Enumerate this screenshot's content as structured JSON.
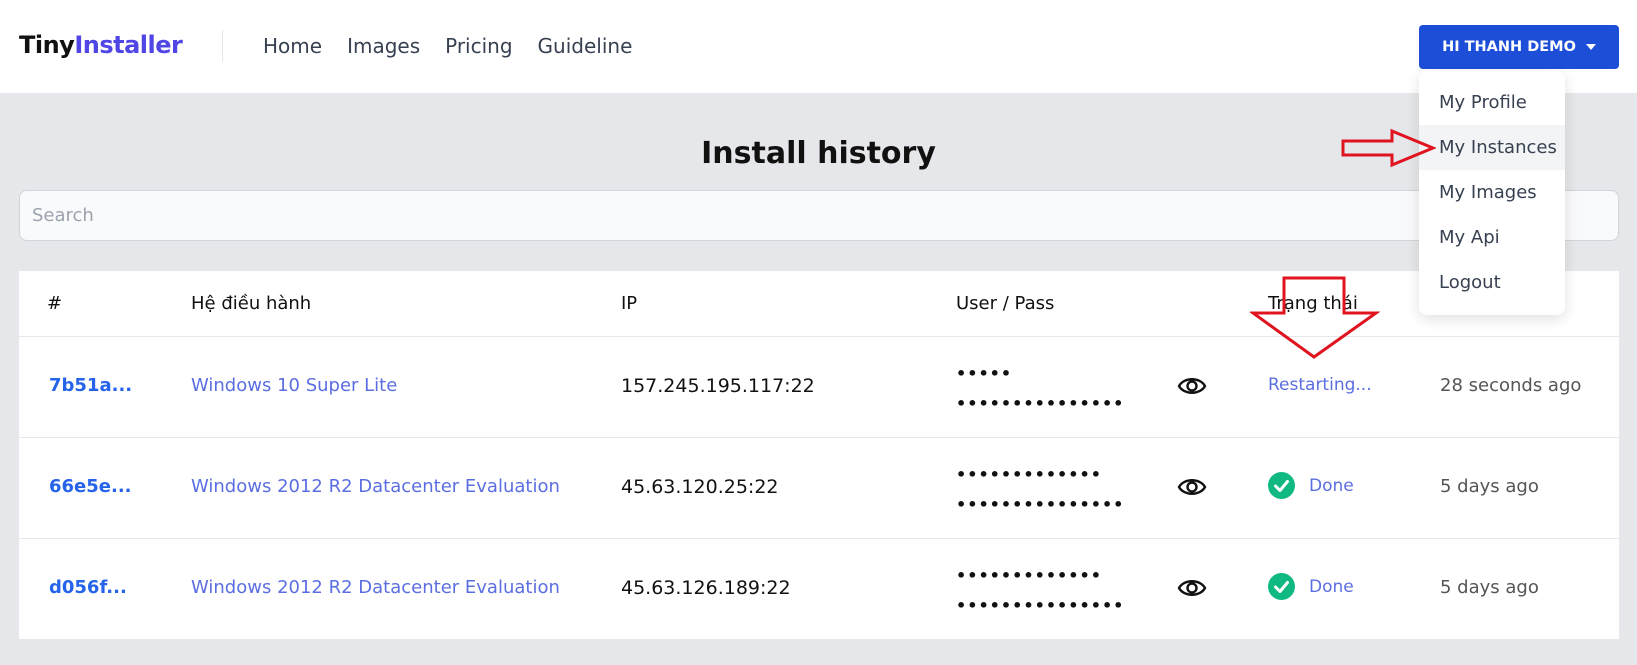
{
  "brand": {
    "part1": "Tiny",
    "part2": "Installer"
  },
  "nav": {
    "items": [
      {
        "label": "Home"
      },
      {
        "label": "Images"
      },
      {
        "label": "Pricing"
      },
      {
        "label": "Guideline"
      }
    ]
  },
  "user_menu": {
    "button_label": "HI THANH DEMO",
    "items": [
      {
        "label": "My Profile"
      },
      {
        "label": "My Instances"
      },
      {
        "label": "My Images"
      },
      {
        "label": "My Api"
      },
      {
        "label": "Logout"
      }
    ],
    "active_item": "My Instances"
  },
  "page": {
    "title": "Install history"
  },
  "search": {
    "placeholder": "Search",
    "value": ""
  },
  "table": {
    "headers": {
      "id": "#",
      "os": "Hệ điều hành",
      "ip": "IP",
      "user_pass": "User / Pass",
      "status": "Trạng thái"
    },
    "rows": [
      {
        "id": "7b51a...",
        "os": "Windows 10 Super Lite",
        "ip": "157.245.195.117:22",
        "user": "•••••",
        "pass": "•••••••••••••••",
        "status": "Restarting...",
        "status_icon": "",
        "time": "28 seconds ago"
      },
      {
        "id": "66e5e...",
        "os": "Windows 2012 R2 Datacenter Evaluation",
        "ip": "45.63.120.25:22",
        "user": "•••••••••••••",
        "pass": "•••••••••••••••",
        "status": "Done",
        "status_icon": "check-circle-icon",
        "time": "5 days ago"
      },
      {
        "id": "d056f...",
        "os": "Windows 2012 R2 Datacenter Evaluation",
        "ip": "45.63.126.189:22",
        "user": "•••••••••••••",
        "pass": "•••••••••••••••",
        "status": "Done",
        "status_icon": "check-circle-icon",
        "time": "5 days ago"
      }
    ]
  },
  "colors": {
    "primary": "#1d4ed8",
    "brand_accent": "#4f46e5",
    "link": "#5b6ee1",
    "done": "#10b981",
    "annotation": "#e0141e"
  }
}
